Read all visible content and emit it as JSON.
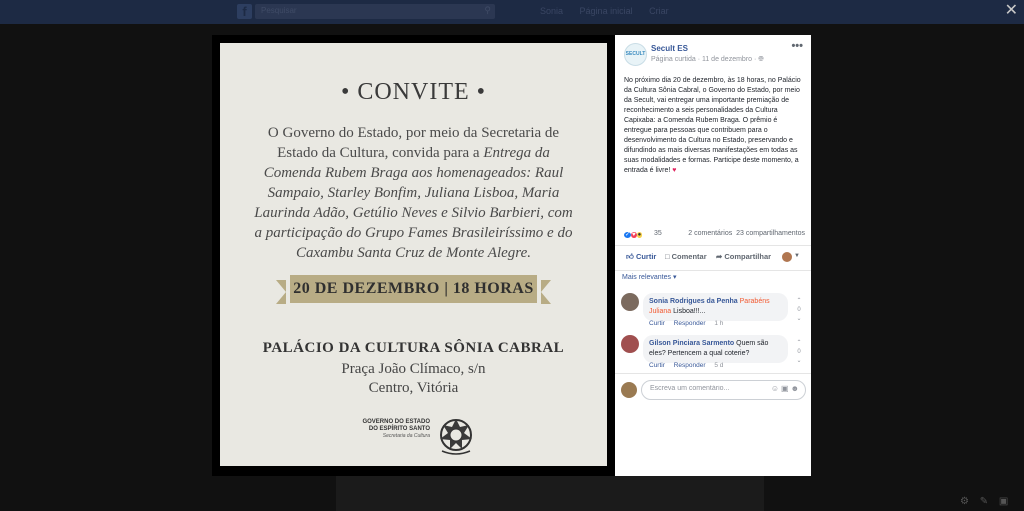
{
  "topbar": {
    "logo": "f",
    "search_placeholder": "Pesquisar",
    "nav": [
      "Sonia",
      "Página inicial",
      "Criar"
    ],
    "close": "✕"
  },
  "invite": {
    "title": "• CONVITE •",
    "body_plain": "O Governo do Estado, por meio da Secretaria de Estado da Cultura, convida para a ",
    "body_italic": "Entrega da Comenda Rubem Braga aos homenageados: Raul Sampaio, Starley Bonfim, Juliana Lisboa, Maria Laurinda Adão, Getúlio Neves e Silvio Barbieri, com a participação do Grupo Fames Brasileiríssimo e do Caxambu Santa Cruz de Monte Alegre.",
    "ribbon": "20 DE DEZEMBRO | 18 HORAS",
    "venue": "PALÁCIO DA CULTURA SÔNIA CABRAL",
    "address1": "Praça João Clímaco, s/n",
    "address2": "Centro, Vitória",
    "gov_line1": "GOVERNO DO ESTADO",
    "gov_line2": "DO ESPÍRITO SANTO",
    "gov_line3": "Secretaria da Cultura"
  },
  "post": {
    "page_name": "Secult ES",
    "meta": "Página curtida · 11 de dezembro · ",
    "avatar_text": "SECULT",
    "text": "No próximo dia 20 de dezembro, às 18 horas, no Palácio da Cultura Sônia Cabral, o Governo do Estado, por meio da Secult, vai entregar uma importante premiação de reconhecimento a seis personalidades da Cultura Capixaba: a Comenda Rubem Braga. O prêmio é entregue para pessoas que contribuem para o desenvolvimento da Cultura no Estado, preservando e difundindo as mais diversas manifestações em todas as suas modalidades e formas. Participe deste momento, a entrada é livre! ",
    "heart": "♥",
    "reactions_count": "35",
    "comments_count": "2 comentários",
    "shares_count": "23 compartilhamentos",
    "action_like": "Curtir",
    "action_comment": "Comentar",
    "action_share": "Compartilhar",
    "relevant": "Mais relevantes ▾"
  },
  "comments": [
    {
      "author": "Sonia Rodrigues da Penha",
      "tag": "Parabéns Juliana",
      "text": " Lisboa!!!...",
      "votes": "0",
      "like": "Curtir",
      "reply": "Responder",
      "time": "1 h"
    },
    {
      "author": "Gilson Pinciara Sarmento",
      "tag": "",
      "text": " Quem são eles? Pertencem a qual coterie?",
      "votes": "0",
      "like": "Curtir",
      "reply": "Responder",
      "time": "5 d"
    }
  ],
  "composer": {
    "placeholder": "Escreva um comentário..."
  },
  "colors": {
    "fb_blue": "#385898",
    "ribbon": "#b8ac85",
    "card_bg": "#e9e8e2"
  }
}
